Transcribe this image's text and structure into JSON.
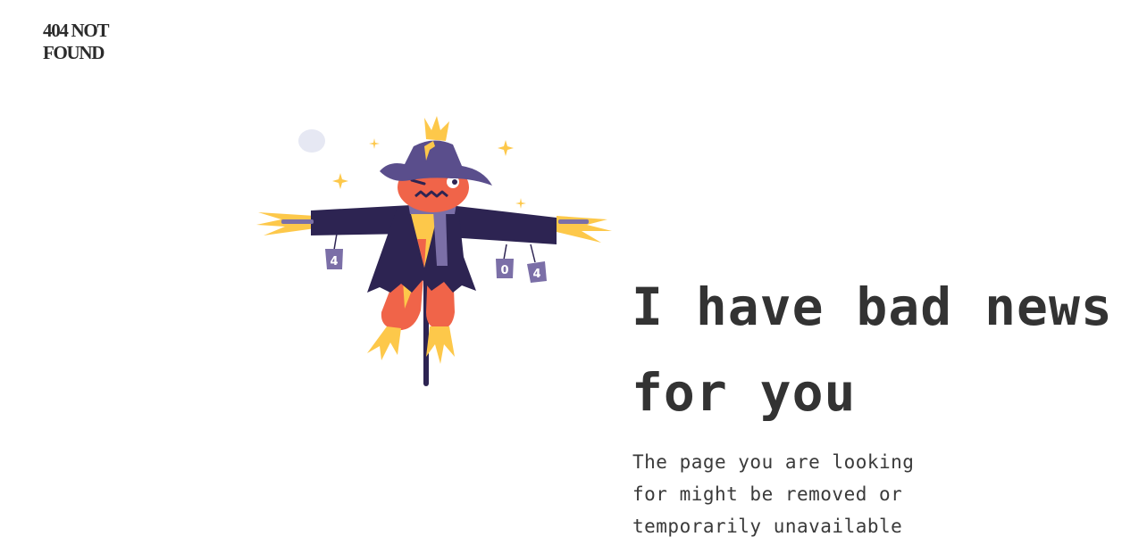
{
  "brand": {
    "text": "404 NOT FOUND"
  },
  "illustration": {
    "icon": "scarecrow-illustration",
    "can_labels": [
      "4",
      "0",
      "4"
    ],
    "colors": {
      "coat": "#2d2452",
      "hat": "#5a4e8c",
      "face": "#f06449",
      "straw": "#fdc84a",
      "cans": "#7b6fa7",
      "moon": "#e6e8f3"
    }
  },
  "content": {
    "headline": "I have bad news for you",
    "message": "The page you are looking for might be removed or temporarily unavailable"
  }
}
